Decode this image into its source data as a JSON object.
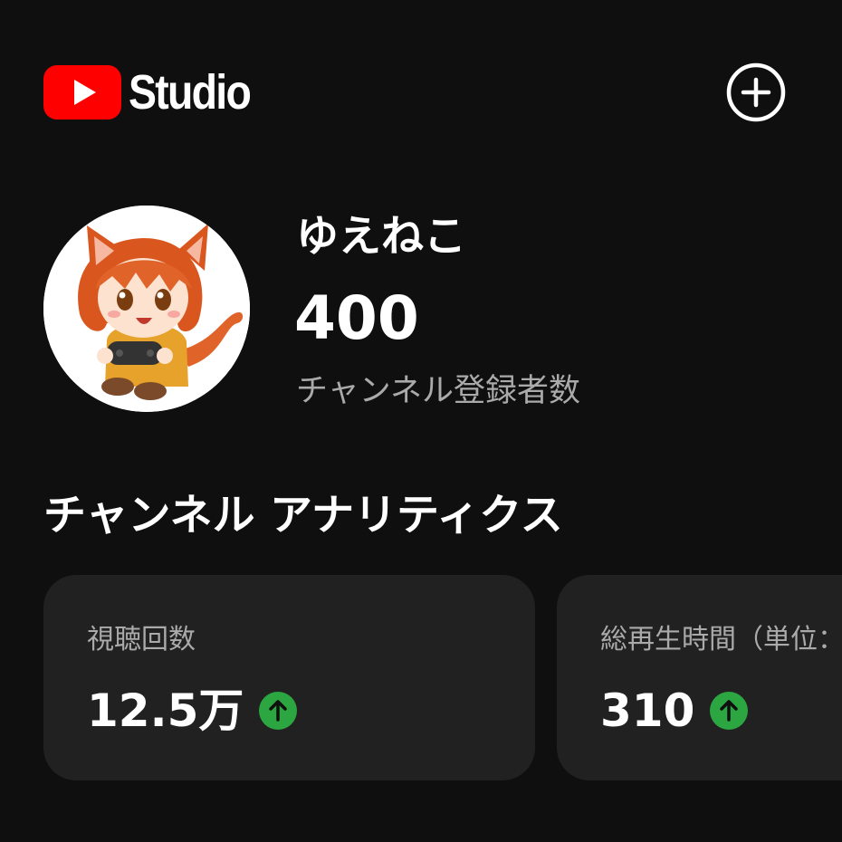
{
  "header": {
    "logo_text": "Studio",
    "brand_color": "#ff0000",
    "create_icon": "add-circle-icon"
  },
  "channel": {
    "name": "ゆえねこ",
    "subscriber_count": "400",
    "subscriber_label": "チャンネル登録者数",
    "avatar_icon": "cat-girl-avatar"
  },
  "analytics": {
    "title": "チャンネル アナリティクス",
    "cards": [
      {
        "label": "視聴回数",
        "value": "12.5万",
        "trend": "up",
        "trend_icon": "arrow-up-icon"
      },
      {
        "label": "総再生時間（単位：",
        "value": "310",
        "trend": "up",
        "trend_icon": "arrow-up-icon"
      }
    ],
    "trend_color": "#2ba640"
  }
}
